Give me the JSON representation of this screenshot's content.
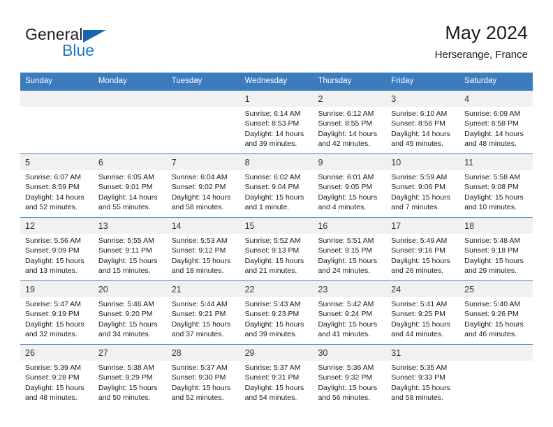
{
  "brand": {
    "name_part1": "General",
    "name_part2": "Blue",
    "triangle_color": "#1565b5",
    "blue_color": "#1f7cc4"
  },
  "header": {
    "title": "May 2024",
    "subtitle": "Herserange, France"
  },
  "theme": {
    "header_blue": "#3a7cbe",
    "daynum_band": "#f1f1f1",
    "text": "#1a1a1a"
  },
  "weekdays": [
    "Sunday",
    "Monday",
    "Tuesday",
    "Wednesday",
    "Thursday",
    "Friday",
    "Saturday"
  ],
  "labels": {
    "sunrise_prefix": "Sunrise:",
    "sunset_prefix": "Sunset:",
    "daylight_prefix": "Daylight:"
  },
  "weeks": [
    [
      {
        "day": "",
        "sunrise": "",
        "sunset": "",
        "daylight_line1": "",
        "daylight_line2": ""
      },
      {
        "day": "",
        "sunrise": "",
        "sunset": "",
        "daylight_line1": "",
        "daylight_line2": ""
      },
      {
        "day": "",
        "sunrise": "",
        "sunset": "",
        "daylight_line1": "",
        "daylight_line2": ""
      },
      {
        "day": "1",
        "sunrise": "Sunrise: 6:14 AM",
        "sunset": "Sunset: 8:53 PM",
        "daylight_line1": "Daylight: 14 hours",
        "daylight_line2": "and 39 minutes."
      },
      {
        "day": "2",
        "sunrise": "Sunrise: 6:12 AM",
        "sunset": "Sunset: 8:55 PM",
        "daylight_line1": "Daylight: 14 hours",
        "daylight_line2": "and 42 minutes."
      },
      {
        "day": "3",
        "sunrise": "Sunrise: 6:10 AM",
        "sunset": "Sunset: 8:56 PM",
        "daylight_line1": "Daylight: 14 hours",
        "daylight_line2": "and 45 minutes."
      },
      {
        "day": "4",
        "sunrise": "Sunrise: 6:09 AM",
        "sunset": "Sunset: 8:58 PM",
        "daylight_line1": "Daylight: 14 hours",
        "daylight_line2": "and 48 minutes."
      }
    ],
    [
      {
        "day": "5",
        "sunrise": "Sunrise: 6:07 AM",
        "sunset": "Sunset: 8:59 PM",
        "daylight_line1": "Daylight: 14 hours",
        "daylight_line2": "and 52 minutes."
      },
      {
        "day": "6",
        "sunrise": "Sunrise: 6:05 AM",
        "sunset": "Sunset: 9:01 PM",
        "daylight_line1": "Daylight: 14 hours",
        "daylight_line2": "and 55 minutes."
      },
      {
        "day": "7",
        "sunrise": "Sunrise: 6:04 AM",
        "sunset": "Sunset: 9:02 PM",
        "daylight_line1": "Daylight: 14 hours",
        "daylight_line2": "and 58 minutes."
      },
      {
        "day": "8",
        "sunrise": "Sunrise: 6:02 AM",
        "sunset": "Sunset: 9:04 PM",
        "daylight_line1": "Daylight: 15 hours",
        "daylight_line2": "and 1 minute."
      },
      {
        "day": "9",
        "sunrise": "Sunrise: 6:01 AM",
        "sunset": "Sunset: 9:05 PM",
        "daylight_line1": "Daylight: 15 hours",
        "daylight_line2": "and 4 minutes."
      },
      {
        "day": "10",
        "sunrise": "Sunrise: 5:59 AM",
        "sunset": "Sunset: 9:06 PM",
        "daylight_line1": "Daylight: 15 hours",
        "daylight_line2": "and 7 minutes."
      },
      {
        "day": "11",
        "sunrise": "Sunrise: 5:58 AM",
        "sunset": "Sunset: 9:08 PM",
        "daylight_line1": "Daylight: 15 hours",
        "daylight_line2": "and 10 minutes."
      }
    ],
    [
      {
        "day": "12",
        "sunrise": "Sunrise: 5:56 AM",
        "sunset": "Sunset: 9:09 PM",
        "daylight_line1": "Daylight: 15 hours",
        "daylight_line2": "and 13 minutes."
      },
      {
        "day": "13",
        "sunrise": "Sunrise: 5:55 AM",
        "sunset": "Sunset: 9:11 PM",
        "daylight_line1": "Daylight: 15 hours",
        "daylight_line2": "and 15 minutes."
      },
      {
        "day": "14",
        "sunrise": "Sunrise: 5:53 AM",
        "sunset": "Sunset: 9:12 PM",
        "daylight_line1": "Daylight: 15 hours",
        "daylight_line2": "and 18 minutes."
      },
      {
        "day": "15",
        "sunrise": "Sunrise: 5:52 AM",
        "sunset": "Sunset: 9:13 PM",
        "daylight_line1": "Daylight: 15 hours",
        "daylight_line2": "and 21 minutes."
      },
      {
        "day": "16",
        "sunrise": "Sunrise: 5:51 AM",
        "sunset": "Sunset: 9:15 PM",
        "daylight_line1": "Daylight: 15 hours",
        "daylight_line2": "and 24 minutes."
      },
      {
        "day": "17",
        "sunrise": "Sunrise: 5:49 AM",
        "sunset": "Sunset: 9:16 PM",
        "daylight_line1": "Daylight: 15 hours",
        "daylight_line2": "and 26 minutes."
      },
      {
        "day": "18",
        "sunrise": "Sunrise: 5:48 AM",
        "sunset": "Sunset: 9:18 PM",
        "daylight_line1": "Daylight: 15 hours",
        "daylight_line2": "and 29 minutes."
      }
    ],
    [
      {
        "day": "19",
        "sunrise": "Sunrise: 5:47 AM",
        "sunset": "Sunset: 9:19 PM",
        "daylight_line1": "Daylight: 15 hours",
        "daylight_line2": "and 32 minutes."
      },
      {
        "day": "20",
        "sunrise": "Sunrise: 5:46 AM",
        "sunset": "Sunset: 9:20 PM",
        "daylight_line1": "Daylight: 15 hours",
        "daylight_line2": "and 34 minutes."
      },
      {
        "day": "21",
        "sunrise": "Sunrise: 5:44 AM",
        "sunset": "Sunset: 9:21 PM",
        "daylight_line1": "Daylight: 15 hours",
        "daylight_line2": "and 37 minutes."
      },
      {
        "day": "22",
        "sunrise": "Sunrise: 5:43 AM",
        "sunset": "Sunset: 9:23 PM",
        "daylight_line1": "Daylight: 15 hours",
        "daylight_line2": "and 39 minutes."
      },
      {
        "day": "23",
        "sunrise": "Sunrise: 5:42 AM",
        "sunset": "Sunset: 9:24 PM",
        "daylight_line1": "Daylight: 15 hours",
        "daylight_line2": "and 41 minutes."
      },
      {
        "day": "24",
        "sunrise": "Sunrise: 5:41 AM",
        "sunset": "Sunset: 9:25 PM",
        "daylight_line1": "Daylight: 15 hours",
        "daylight_line2": "and 44 minutes."
      },
      {
        "day": "25",
        "sunrise": "Sunrise: 5:40 AM",
        "sunset": "Sunset: 9:26 PM",
        "daylight_line1": "Daylight: 15 hours",
        "daylight_line2": "and 46 minutes."
      }
    ],
    [
      {
        "day": "26",
        "sunrise": "Sunrise: 5:39 AM",
        "sunset": "Sunset: 9:28 PM",
        "daylight_line1": "Daylight: 15 hours",
        "daylight_line2": "and 48 minutes."
      },
      {
        "day": "27",
        "sunrise": "Sunrise: 5:38 AM",
        "sunset": "Sunset: 9:29 PM",
        "daylight_line1": "Daylight: 15 hours",
        "daylight_line2": "and 50 minutes."
      },
      {
        "day": "28",
        "sunrise": "Sunrise: 5:37 AM",
        "sunset": "Sunset: 9:30 PM",
        "daylight_line1": "Daylight: 15 hours",
        "daylight_line2": "and 52 minutes."
      },
      {
        "day": "29",
        "sunrise": "Sunrise: 5:37 AM",
        "sunset": "Sunset: 9:31 PM",
        "daylight_line1": "Daylight: 15 hours",
        "daylight_line2": "and 54 minutes."
      },
      {
        "day": "30",
        "sunrise": "Sunrise: 5:36 AM",
        "sunset": "Sunset: 9:32 PM",
        "daylight_line1": "Daylight: 15 hours",
        "daylight_line2": "and 56 minutes."
      },
      {
        "day": "31",
        "sunrise": "Sunrise: 5:35 AM",
        "sunset": "Sunset: 9:33 PM",
        "daylight_line1": "Daylight: 15 hours",
        "daylight_line2": "and 58 minutes."
      },
      {
        "day": "",
        "sunrise": "",
        "sunset": "",
        "daylight_line1": "",
        "daylight_line2": ""
      }
    ]
  ]
}
